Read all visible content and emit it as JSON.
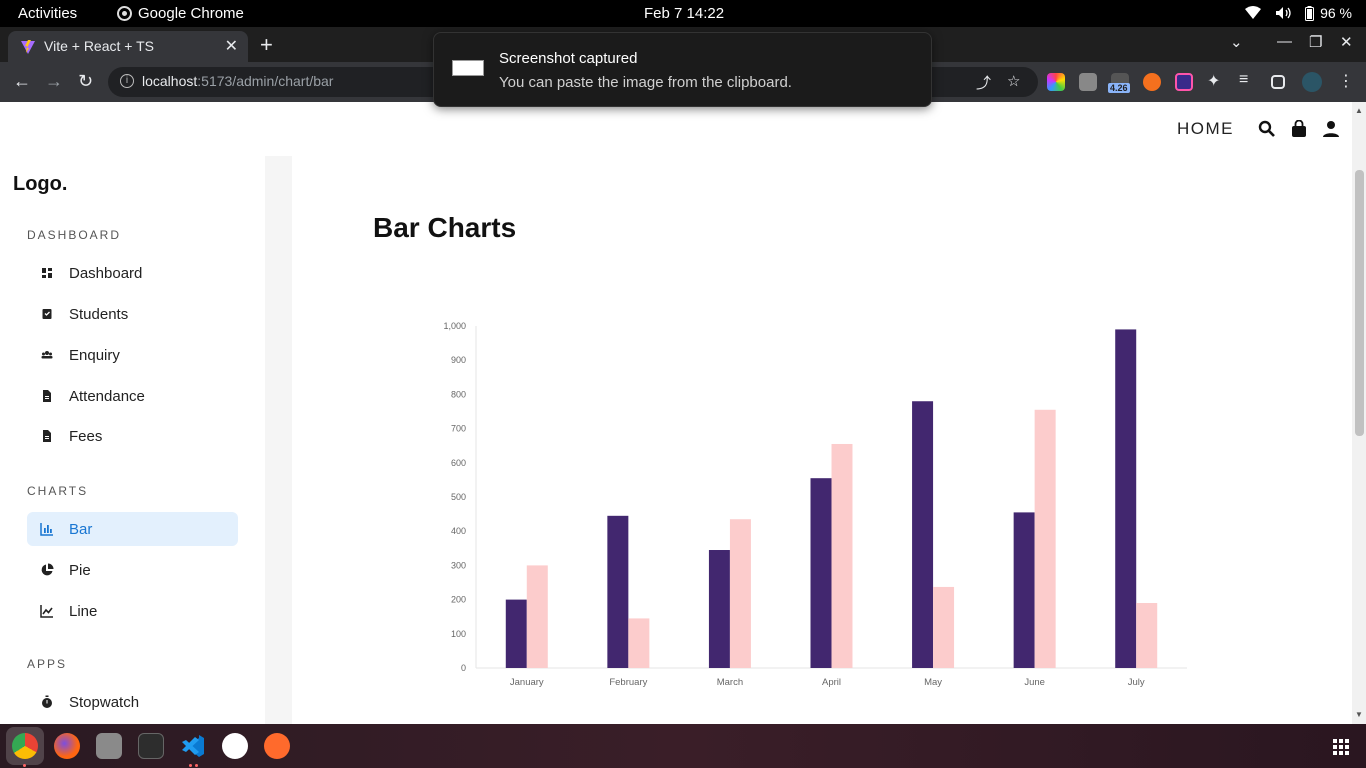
{
  "system_bar": {
    "activities": "Activities",
    "app_name": "Google Chrome",
    "clock": "Feb 7  14:22",
    "battery": "96 %"
  },
  "browser": {
    "tab_title": "Vite + React + TS",
    "url_host": "localhost",
    "url_path": ":5173/admin/chart/bar",
    "extension_badge": "4.26"
  },
  "notification": {
    "title": "Screenshot captured",
    "body": "You can paste the image from the clipboard."
  },
  "header": {
    "home": "HOME"
  },
  "sidebar": {
    "logo": "Logo.",
    "sections": [
      {
        "title": "DASHBOARD"
      },
      {
        "title": "CHARTS"
      },
      {
        "title": "APPS"
      }
    ],
    "items": [
      {
        "label": "Dashboard",
        "icon": "dashboard-icon"
      },
      {
        "label": "Students",
        "icon": "students-icon"
      },
      {
        "label": "Enquiry",
        "icon": "enquiry-icon"
      },
      {
        "label": "Attendance",
        "icon": "attendance-icon"
      },
      {
        "label": "Fees",
        "icon": "fees-icon"
      },
      {
        "label": "Bar",
        "icon": "bar-chart-icon",
        "active": true
      },
      {
        "label": "Pie",
        "icon": "pie-chart-icon"
      },
      {
        "label": "Line",
        "icon": "line-chart-icon"
      },
      {
        "label": "Stopwatch",
        "icon": "stopwatch-icon"
      }
    ]
  },
  "main": {
    "title": "Bar Charts"
  },
  "colors": {
    "series_1": "#42276f",
    "series_2": "#fccccc",
    "active_item_bg": "#e3f0fd",
    "active_item_text": "#1976d2"
  },
  "chart_data": {
    "type": "bar",
    "categories": [
      "January",
      "February",
      "March",
      "April",
      "May",
      "June",
      "July"
    ],
    "series": [
      {
        "values": [
          200,
          445,
          345,
          555,
          780,
          455,
          990
        ]
      },
      {
        "values": [
          300,
          145,
          435,
          655,
          237,
          755,
          190
        ]
      }
    ],
    "ylim": [
      0,
      1000
    ],
    "yticks": [
      "0",
      "100",
      "200",
      "300",
      "400",
      "500",
      "600",
      "700",
      "800",
      "900",
      "1,000"
    ],
    "grid": false
  }
}
